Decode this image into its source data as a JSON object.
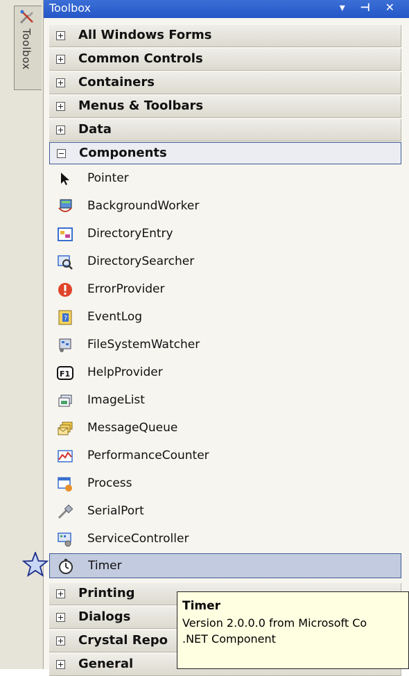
{
  "sidebar": {
    "tab_label": "Toolbox"
  },
  "toolbox": {
    "title": "Toolbox",
    "title_icons": "▾ ⊣ ✕",
    "sections_top": [
      {
        "label": "All Windows Forms"
      },
      {
        "label": "Common Controls"
      },
      {
        "label": "Containers"
      },
      {
        "label": "Menus & Toolbars"
      },
      {
        "label": "Data"
      }
    ],
    "open_section": {
      "label": "Components"
    },
    "items": [
      {
        "label": "Pointer",
        "icon": "pointer-icon"
      },
      {
        "label": "BackgroundWorker",
        "icon": "background-worker-icon"
      },
      {
        "label": "DirectoryEntry",
        "icon": "directory-entry-icon"
      },
      {
        "label": "DirectorySearcher",
        "icon": "directory-searcher-icon"
      },
      {
        "label": "ErrorProvider",
        "icon": "error-provider-icon"
      },
      {
        "label": "EventLog",
        "icon": "event-log-icon"
      },
      {
        "label": "FileSystemWatcher",
        "icon": "file-system-watcher-icon"
      },
      {
        "label": "HelpProvider",
        "icon": "help-provider-icon"
      },
      {
        "label": "ImageList",
        "icon": "image-list-icon"
      },
      {
        "label": "MessageQueue",
        "icon": "message-queue-icon"
      },
      {
        "label": "PerformanceCounter",
        "icon": "performance-counter-icon"
      },
      {
        "label": "Process",
        "icon": "process-icon"
      },
      {
        "label": "SerialPort",
        "icon": "serial-port-icon"
      },
      {
        "label": "ServiceController",
        "icon": "service-controller-icon"
      },
      {
        "label": "Timer",
        "icon": "timer-icon"
      }
    ],
    "sections_bottom": [
      {
        "label": "Printing"
      },
      {
        "label": "Dialogs"
      },
      {
        "label": "Crystal Repo"
      },
      {
        "label": "General"
      }
    ]
  },
  "tooltip": {
    "title": "Timer",
    "line1": "Version 2.0.0.0 from Microsoft Co",
    "line2": ".NET Component"
  },
  "colors": {
    "selection": "#c3cbe0",
    "selection_border": "#3d5a94",
    "tooltip_bg": "#ffffe1",
    "title_bar": "#2556c7"
  }
}
